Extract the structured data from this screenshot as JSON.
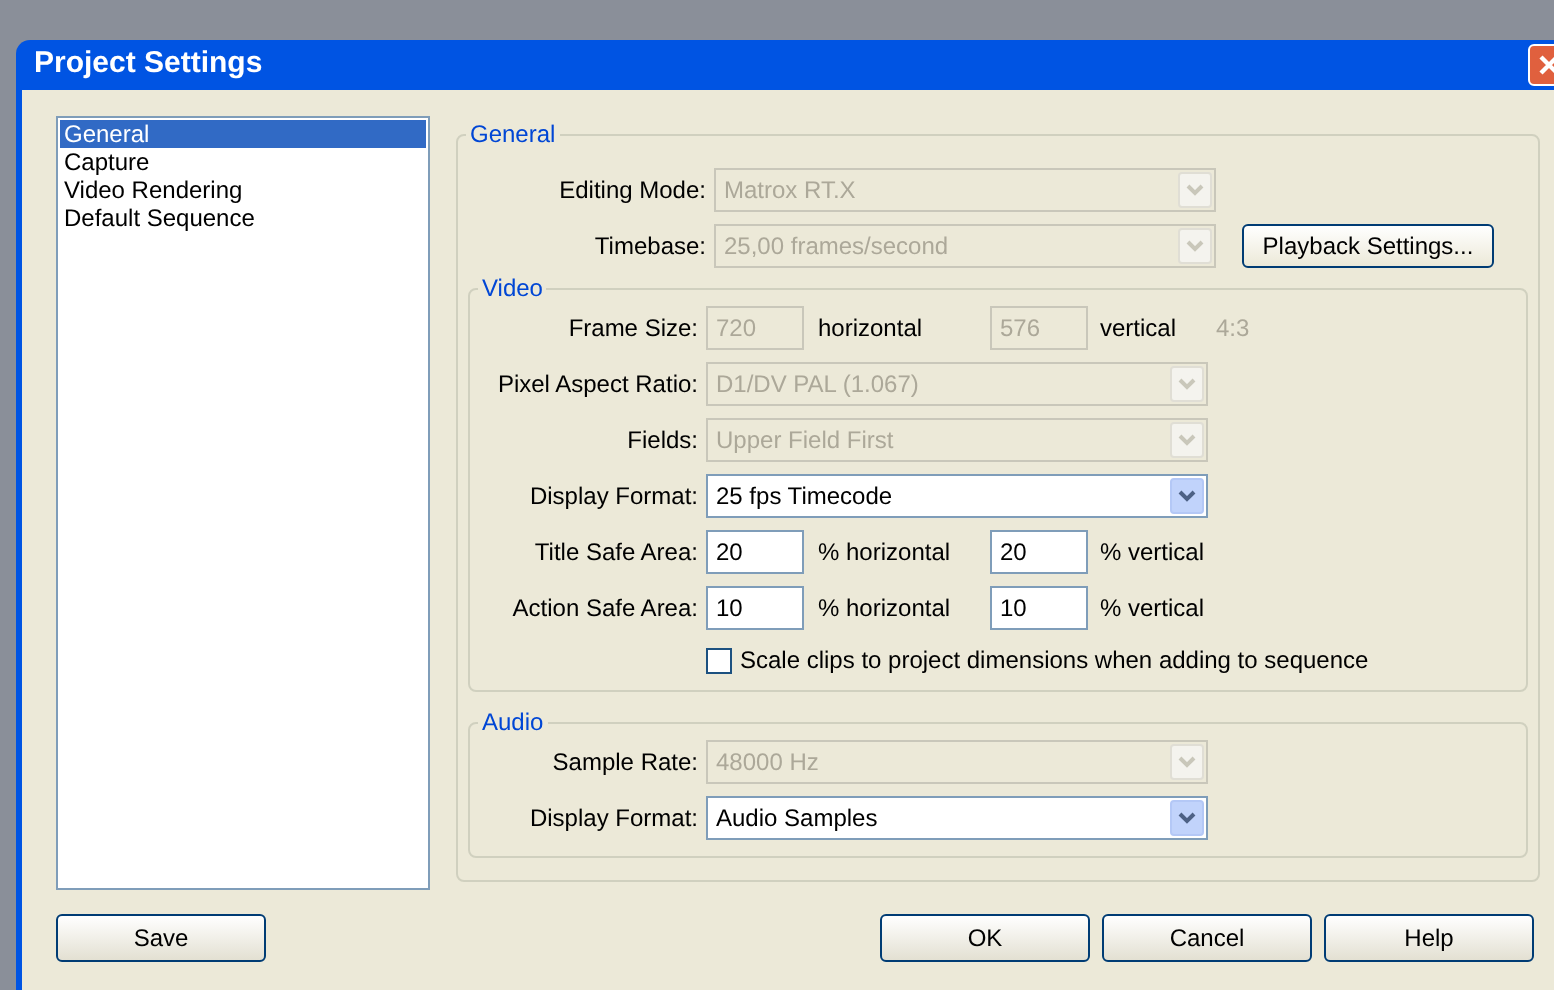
{
  "window": {
    "title": "Project Settings"
  },
  "sidebar": {
    "items": [
      {
        "label": "General",
        "selected": true
      },
      {
        "label": "Capture",
        "selected": false
      },
      {
        "label": "Video Rendering",
        "selected": false
      },
      {
        "label": "Default Sequence",
        "selected": false
      }
    ]
  },
  "general": {
    "title": "General",
    "rows": [
      {
        "kind": "select",
        "label": "Editing Mode:",
        "value": "Matrox RT.X",
        "disabled": true
      },
      {
        "kind": "select",
        "label": "Timebase:",
        "value": "25,00 frames/second",
        "disabled": true,
        "button": "Playback Settings..."
      }
    ]
  },
  "video": {
    "title": "Video",
    "rows": [
      {
        "kind": "pair",
        "label": "Frame Size:",
        "value_1": "720",
        "unit_1": "horizontal",
        "value_2": "576",
        "unit_2": "vertical",
        "note": "4:3",
        "disabled": true
      },
      {
        "kind": "select",
        "label": "Pixel Aspect Ratio:",
        "value": "D1/DV PAL (1.067)",
        "disabled": true
      },
      {
        "kind": "select",
        "label": "Fields:",
        "value": "Upper Field First",
        "disabled": true
      },
      {
        "kind": "select",
        "label": "Display Format:",
        "value": "25 fps Timecode",
        "disabled": false
      },
      {
        "kind": "pair",
        "label": "Title Safe Area:",
        "value_1": "20",
        "unit_1": "% horizontal",
        "value_2": "20",
        "unit_2": "% vertical",
        "disabled": false
      },
      {
        "kind": "pair",
        "label": "Action Safe Area:",
        "value_1": "10",
        "unit_1": "% horizontal",
        "value_2": "10",
        "unit_2": "% vertical",
        "disabled": false
      },
      {
        "kind": "checkbox",
        "label": "Scale clips to project dimensions when adding to sequence",
        "checked": false
      }
    ]
  },
  "audio": {
    "title": "Audio",
    "rows": [
      {
        "kind": "select",
        "label": "Sample Rate:",
        "value": "48000 Hz",
        "disabled": true
      },
      {
        "kind": "select",
        "label": "Display Format:",
        "value": "Audio Samples",
        "disabled": false
      }
    ]
  },
  "buttons": {
    "left": [
      "Save"
    ],
    "right": [
      "OK",
      "Cancel",
      "Help"
    ]
  }
}
